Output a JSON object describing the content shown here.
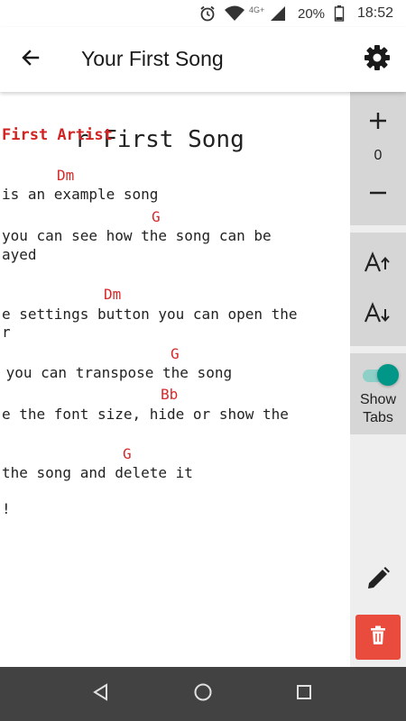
{
  "status_bar": {
    "network": "4G+",
    "battery_percent": "20%",
    "time": "18:52",
    "icons": [
      "alarm-icon",
      "wifi-icon",
      "signal-icon",
      "battery-icon"
    ]
  },
  "app_bar": {
    "title": "Your First Song",
    "back_icon": "arrow-back-icon",
    "settings_icon": "gear-icon"
  },
  "song": {
    "title_visible": "r First Song",
    "artist_visible": "First Artist",
    "chords": [
      "Dm",
      "G",
      "Dm",
      "G",
      "Bb",
      "G"
    ],
    "lyrics": [
      "is an example song",
      "you can see how the song can be",
      "ayed",
      "e settings button you can open the",
      "r",
      " you can transpose the song",
      "e the font size, hide or show the",
      "the song and delete it",
      "!"
    ]
  },
  "panel": {
    "transpose_value": "0",
    "increase_icon": "plus-icon",
    "decrease_icon": "minus-icon",
    "font_increase_icon": "font-size-increase-icon",
    "font_decrease_icon": "font-size-decrease-icon",
    "show_tabs_line1": "Show",
    "show_tabs_line2": "Tabs",
    "show_tabs_on": true,
    "edit_icon": "pencil-icon",
    "delete_icon": "trash-icon"
  },
  "colors": {
    "chord": "#d42a2a",
    "artist": "#d32222",
    "toggle": "#009688",
    "delete": "#e94b3c",
    "panel_group": "#d6d6d6",
    "nav_bar": "#424242"
  },
  "nav_bar": {
    "back_icon": "nav-back-icon",
    "home_icon": "nav-home-icon",
    "recents_icon": "nav-recents-icon"
  }
}
